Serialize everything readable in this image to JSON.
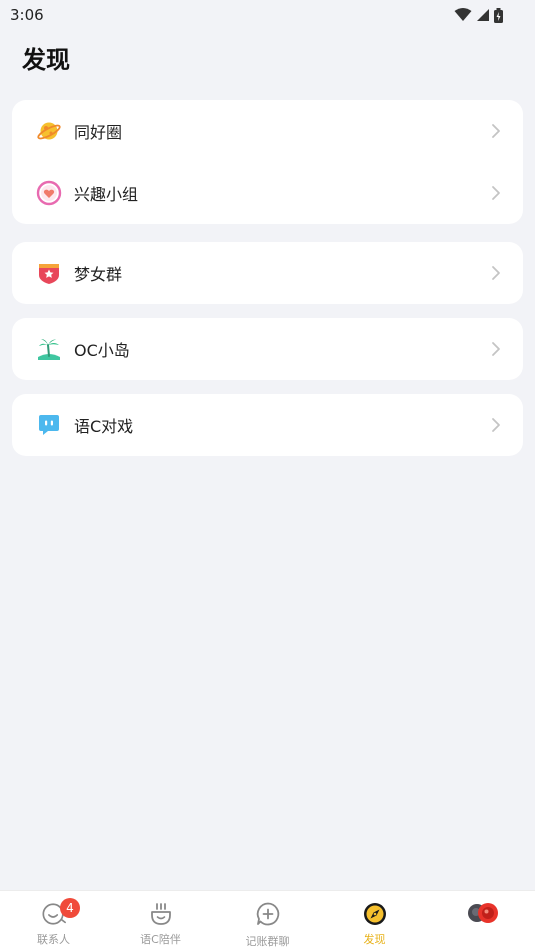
{
  "status_bar": {
    "time": "3:06"
  },
  "page": {
    "title": "发现"
  },
  "cards": [
    {
      "items": [
        {
          "label": "同好圈",
          "icon": "planet-icon"
        },
        {
          "label": "兴趣小组",
          "icon": "heart-ring-icon"
        }
      ]
    },
    {
      "items": [
        {
          "label": "梦女群",
          "icon": "star-shield-icon"
        }
      ]
    },
    {
      "items": [
        {
          "label": "OC小岛",
          "icon": "palm-island-icon"
        }
      ]
    },
    {
      "items": [
        {
          "label": "语C对戏",
          "icon": "chat-bubble-icon"
        }
      ]
    }
  ],
  "tabbar": {
    "tabs": [
      {
        "label": "联系人",
        "badge": "4"
      },
      {
        "label": "语C陪伴"
      },
      {
        "label": "记账群聊"
      },
      {
        "label": "发现",
        "active": true
      }
    ]
  },
  "colors": {
    "accent": "#e8b21a",
    "badge": "#f04a3a",
    "background": "#f2f3f7"
  }
}
